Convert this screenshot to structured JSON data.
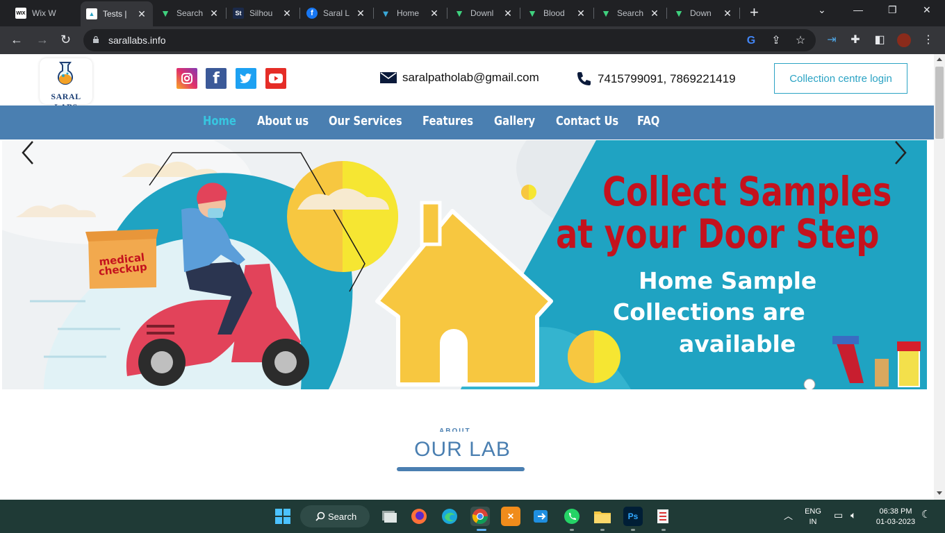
{
  "browser": {
    "tabs": [
      {
        "title": "Wix W",
        "favicon": "WIX",
        "active": false
      },
      {
        "title": "Tests |",
        "favicon": "saral-icon",
        "active": true
      },
      {
        "title": "Search",
        "favicon": "v-icon",
        "active": false
      },
      {
        "title": "Silhou",
        "favicon": "St",
        "active": false
      },
      {
        "title": "Saral L",
        "favicon": "facebook-icon",
        "active": false
      },
      {
        "title": "Home",
        "favicon": "t-icon",
        "active": false
      },
      {
        "title": "Downl",
        "favicon": "v-icon",
        "active": false
      },
      {
        "title": "Blood",
        "favicon": "v-icon",
        "active": false
      },
      {
        "title": "Search",
        "favicon": "v-icon",
        "active": false
      },
      {
        "title": "Down",
        "favicon": "v-icon",
        "active": false
      }
    ],
    "url": "sarallabs.info"
  },
  "site": {
    "logo_text": "SARAL LABS",
    "email": "saralpatholab@gmail.com",
    "phones": "7415799091, 7869221419",
    "login_button": "Collection centre login",
    "nav": [
      {
        "label": "Home",
        "active": true
      },
      {
        "label": "About us",
        "active": false
      },
      {
        "label": "Our Services",
        "active": false
      },
      {
        "label": "Features",
        "active": false
      },
      {
        "label": "Gallery",
        "active": false
      },
      {
        "label": "Contact Us",
        "active": false
      },
      {
        "label": "FAQ",
        "active": false
      }
    ],
    "hero": {
      "headline_1": "Collect Samples",
      "headline_2": "at your Door Step",
      "sub_1": "Home Sample",
      "sub_2": "Collections are",
      "sub_3": "available",
      "box_1": "medical",
      "box_2": "checkup"
    },
    "section_subtitle": "ABOUT",
    "section_title": "OUR LAB"
  },
  "taskbar": {
    "search_label": "Search",
    "lang_1": "ENG",
    "lang_2": "IN",
    "time": "06:38 PM",
    "date": "01-03-2023"
  },
  "colors": {
    "nav_bg": "#4a7fb1",
    "nav_active": "#37c6e0",
    "hero_teal": "#1fa3c2",
    "hero_red": "#c4121d",
    "accent_blue": "#2ba3c4"
  }
}
